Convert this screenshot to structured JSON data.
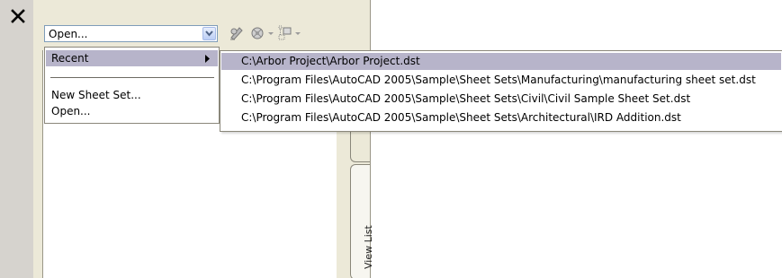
{
  "palette": {
    "close_icon": "close-x-icon",
    "combo": {
      "value": "Open...",
      "dropdown_icon": "chevron-down-icon"
    },
    "toolbar": {
      "icons": [
        "publish-icon",
        "sheet-set-manager-icon",
        "dropdown-arrow-icon",
        "model-view-icon",
        "dropdown-arrow-icon"
      ]
    },
    "menu": {
      "items": [
        {
          "label": "Recent",
          "has_submenu": true
        },
        {
          "label": "New Sheet Set..."
        },
        {
          "label": "Open..."
        }
      ]
    },
    "recent_submenu": {
      "items": [
        "C:\\Arbor Project\\Arbor Project.dst",
        "C:\\Program Files\\AutoCAD 2005\\Sample\\Sheet Sets\\Manufacturing\\manufacturing sheet set.dst",
        "C:\\Program Files\\AutoCAD 2005\\Sample\\Sheet Sets\\Civil\\Civil Sample Sheet Set.dst",
        "C:\\Program Files\\AutoCAD 2005\\Sample\\Sheet Sets\\Architectural\\IRD Addition.dst"
      ]
    },
    "tabs": {
      "view_list": "View List"
    }
  },
  "colors": {
    "highlight": "#b7b4ca",
    "panel": "#ece9d8",
    "title_strip": "#d6d3ce"
  }
}
